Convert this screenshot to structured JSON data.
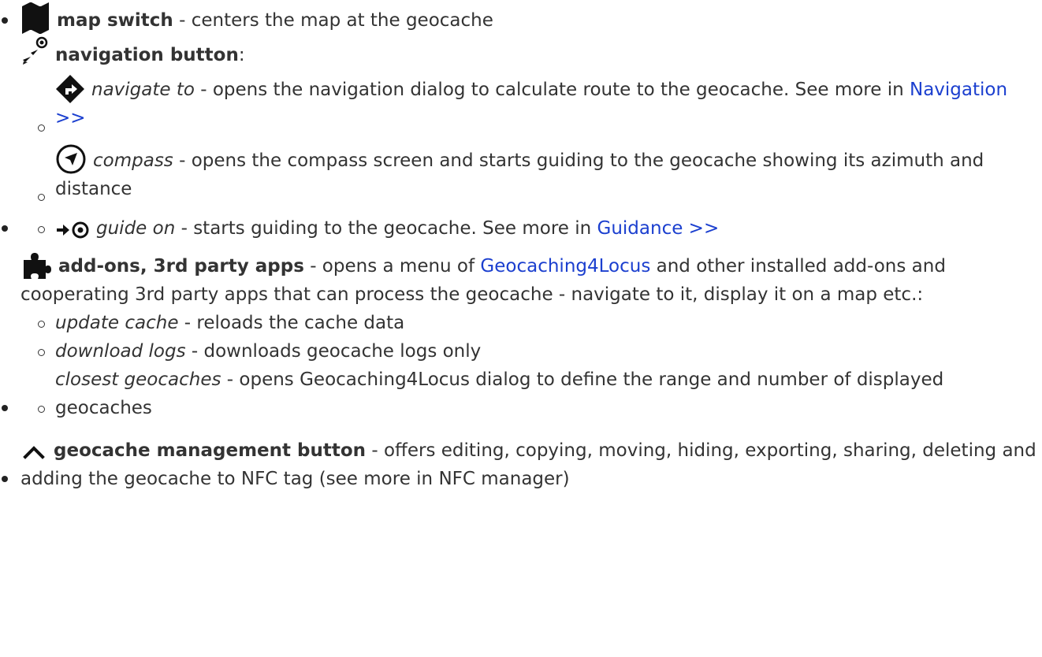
{
  "items": [
    {
      "icon": "map-icon",
      "title": "map switch",
      "desc": " - centers the map at the geocache"
    },
    {
      "icon": "navigation-icon",
      "title": "navigation button",
      "desc": ":",
      "subitems": [
        {
          "icon": "turn-right-diamond-icon",
          "title": "navigate to",
          "desc": " - opens the navigation dialog to calculate route to the geocache. See more in ",
          "link": "Navigation >>"
        },
        {
          "icon": "compass-icon",
          "title": "compass",
          "desc": " - opens the compass screen and starts guiding to the geocache showing its azimuth and distance"
        },
        {
          "icon": "guide-on-icon",
          "title": "guide on",
          "desc": " - starts guiding to the geocache. See more in ",
          "link": "Guidance >>"
        }
      ]
    },
    {
      "icon": "puzzle-icon",
      "title": "add-ons, 3rd party apps",
      "desc_before": " - opens a menu of ",
      "link": "Geocaching4Locus",
      "desc_after": " and other installed add-ons and cooperating 3rd party apps that can process the geocache - navigate to it, display it on a map etc.:",
      "subitems": [
        {
          "title": "update cache",
          "desc": " - reloads the cache data"
        },
        {
          "title": "download logs",
          "desc": " - downloads geocache logs only"
        },
        {
          "title": "closest geocaches",
          "desc": " - opens Geocaching4Locus dialog to define the range and number of displayed geocaches"
        }
      ]
    },
    {
      "icon": "chevron-up-icon",
      "title": "geocache management button",
      "desc": " - offers editing, copying, moving, hiding, exporting, sharing, deleting and adding the geocache to NFC tag (see more in NFC manager)"
    }
  ]
}
